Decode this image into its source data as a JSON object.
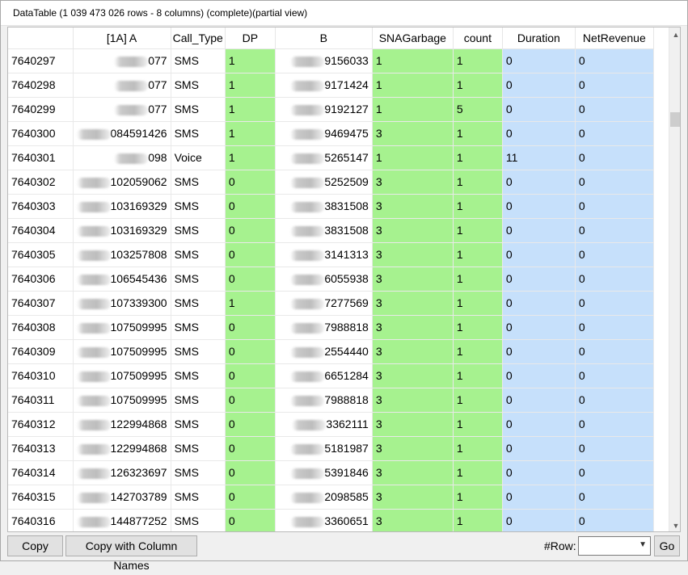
{
  "window": {
    "title": "DataTable (1 039 473 026 rows - 8 columns) (complete)(partial view)"
  },
  "columns": [
    "",
    "[1A] A",
    "Call_Type",
    "DP",
    "B",
    "SNAGarbage",
    "count",
    "Duration",
    "NetRevenue"
  ],
  "rows": [
    {
      "id": "7640297",
      "a": "077",
      "call_type": "SMS",
      "dp": "1",
      "b": "9156033",
      "sna": "1",
      "count": "1",
      "duration": "0",
      "net": "0"
    },
    {
      "id": "7640298",
      "a": "077",
      "call_type": "SMS",
      "dp": "1",
      "b": "9171424",
      "sna": "1",
      "count": "1",
      "duration": "0",
      "net": "0"
    },
    {
      "id": "7640299",
      "a": "077",
      "call_type": "SMS",
      "dp": "1",
      "b": "9192127",
      "sna": "1",
      "count": "5",
      "duration": "0",
      "net": "0"
    },
    {
      "id": "7640300",
      "a": "084591426",
      "call_type": "SMS",
      "dp": "1",
      "b": "9469475",
      "sna": "3",
      "count": "1",
      "duration": "0",
      "net": "0"
    },
    {
      "id": "7640301",
      "a": "098",
      "call_type": "Voice",
      "dp": "1",
      "b": "5265147",
      "sna": "1",
      "count": "1",
      "duration": "11",
      "net": "0"
    },
    {
      "id": "7640302",
      "a": "102059062",
      "call_type": "SMS",
      "dp": "0",
      "b": "5252509",
      "sna": "3",
      "count": "1",
      "duration": "0",
      "net": "0"
    },
    {
      "id": "7640303",
      "a": "103169329",
      "call_type": "SMS",
      "dp": "0",
      "b": "3831508",
      "sna": "3",
      "count": "1",
      "duration": "0",
      "net": "0"
    },
    {
      "id": "7640304",
      "a": "103169329",
      "call_type": "SMS",
      "dp": "0",
      "b": "3831508",
      "sna": "3",
      "count": "1",
      "duration": "0",
      "net": "0"
    },
    {
      "id": "7640305",
      "a": "103257808",
      "call_type": "SMS",
      "dp": "0",
      "b": "3141313",
      "sna": "3",
      "count": "1",
      "duration": "0",
      "net": "0"
    },
    {
      "id": "7640306",
      "a": "106545436",
      "call_type": "SMS",
      "dp": "0",
      "b": "6055938",
      "sna": "3",
      "count": "1",
      "duration": "0",
      "net": "0"
    },
    {
      "id": "7640307",
      "a": "107339300",
      "call_type": "SMS",
      "dp": "1",
      "b": "7277569",
      "sna": "3",
      "count": "1",
      "duration": "0",
      "net": "0"
    },
    {
      "id": "7640308",
      "a": "107509995",
      "call_type": "SMS",
      "dp": "0",
      "b": "7988818",
      "sna": "3",
      "count": "1",
      "duration": "0",
      "net": "0"
    },
    {
      "id": "7640309",
      "a": "107509995",
      "call_type": "SMS",
      "dp": "0",
      "b": "2554440",
      "sna": "3",
      "count": "1",
      "duration": "0",
      "net": "0"
    },
    {
      "id": "7640310",
      "a": "107509995",
      "call_type": "SMS",
      "dp": "0",
      "b": "6651284",
      "sna": "3",
      "count": "1",
      "duration": "0",
      "net": "0"
    },
    {
      "id": "7640311",
      "a": "107509995",
      "call_type": "SMS",
      "dp": "0",
      "b": "7988818",
      "sna": "3",
      "count": "1",
      "duration": "0",
      "net": "0"
    },
    {
      "id": "7640312",
      "a": "122994868",
      "call_type": "SMS",
      "dp": "0",
      "b": "3362111",
      "sna": "3",
      "count": "1",
      "duration": "0",
      "net": "0"
    },
    {
      "id": "7640313",
      "a": "122994868",
      "call_type": "SMS",
      "dp": "0",
      "b": "5181987",
      "sna": "3",
      "count": "1",
      "duration": "0",
      "net": "0"
    },
    {
      "id": "7640314",
      "a": "126323697",
      "call_type": "SMS",
      "dp": "0",
      "b": "5391846",
      "sna": "3",
      "count": "1",
      "duration": "0",
      "net": "0"
    },
    {
      "id": "7640315",
      "a": "142703789",
      "call_type": "SMS",
      "dp": "0",
      "b": "2098585",
      "sna": "3",
      "count": "1",
      "duration": "0",
      "net": "0"
    },
    {
      "id": "7640316",
      "a": "144877252",
      "call_type": "SMS",
      "dp": "0",
      "b": "3360651",
      "sna": "3",
      "count": "1",
      "duration": "0",
      "net": "0"
    }
  ],
  "bottombar": {
    "copy_label": "Copy",
    "copy_names_label": "Copy with Column Names",
    "row_label": "#Row:",
    "row_value": "",
    "go_label": "Go"
  },
  "colors": {
    "green_cell": "#a6f28f",
    "blue_cell": "#c6e0fb"
  },
  "icons": {
    "scroll_up": "chevron-up-icon",
    "scroll_down": "chevron-down-icon",
    "dropdown": "chevron-down-icon"
  }
}
